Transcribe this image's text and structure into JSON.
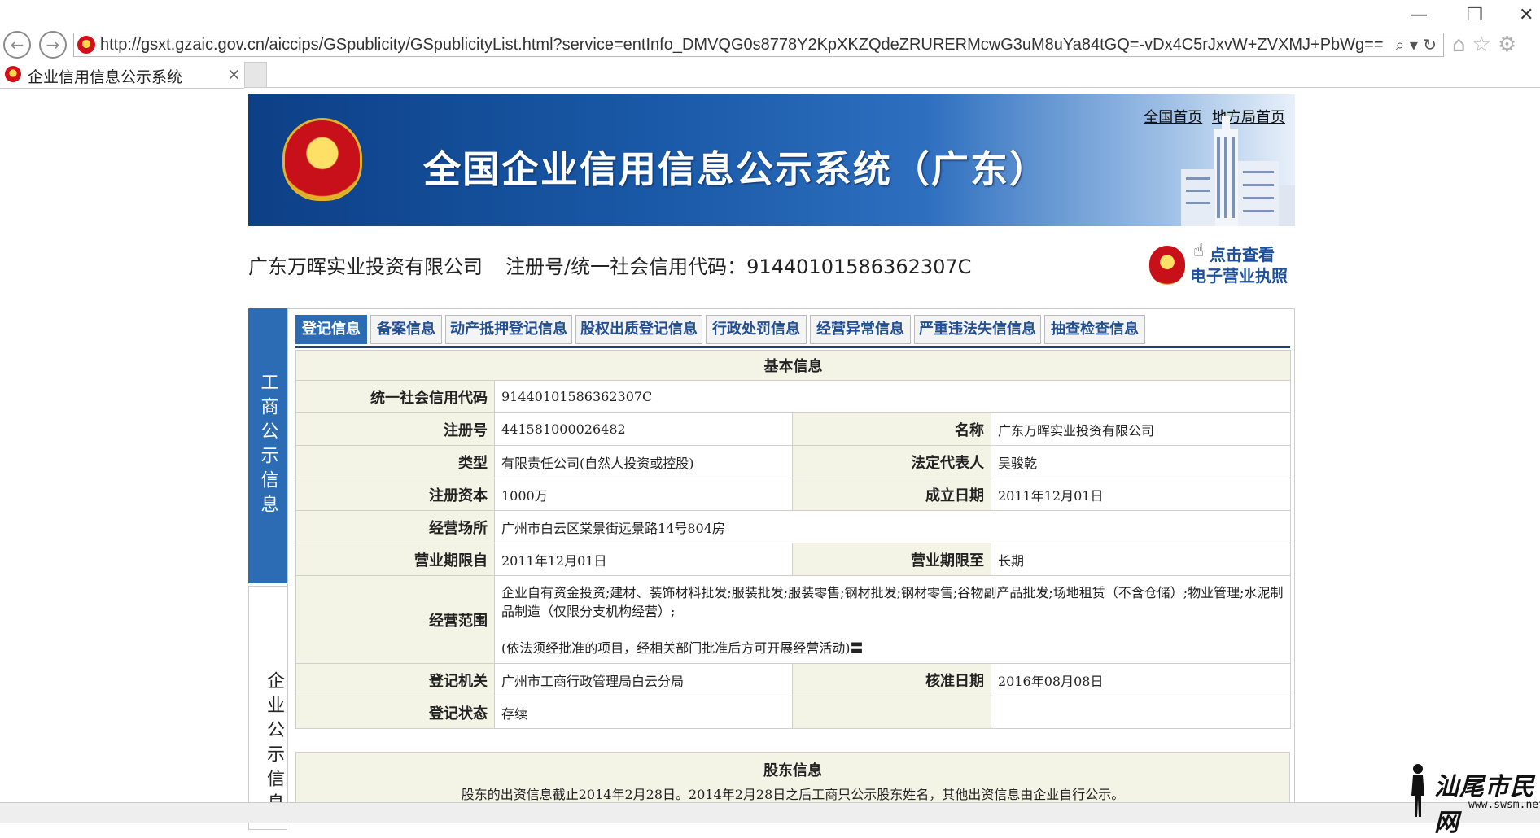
{
  "browser": {
    "url": "http://gsxt.gzaic.gov.cn/aiccips/GSpublicity/GSpublicityList.html?service=entInfo_DMVQG0s8778Y2KpXKZQdeZRURERMcwG3uM8uYa84tGQ=-vDx4C5rJxvW+ZVXMJ+PbWg==",
    "tab_title": "企业信用信息公示系统",
    "tab_close": "×"
  },
  "banner": {
    "title": "全国企业信用信息公示系统（广东）",
    "link_national": "全国首页",
    "link_local": "地方局首页"
  },
  "company": {
    "name": "广东万晖实业投资有限公司",
    "code_label": "注册号/统一社会信用代码：91440101586362307C",
    "license_line1": "点击查看",
    "license_line2": "电子营业执照"
  },
  "side_nav": [
    {
      "label": "工商公示信息"
    },
    {
      "label": "企业公示信息"
    }
  ],
  "tabs": [
    {
      "label": "登记信息"
    },
    {
      "label": "备案信息"
    },
    {
      "label": "动产抵押登记信息"
    },
    {
      "label": "股权出质登记信息"
    },
    {
      "label": "行政处罚信息"
    },
    {
      "label": "经营异常信息"
    },
    {
      "label": "严重违法失信信息"
    },
    {
      "label": "抽查检查信息"
    }
  ],
  "basic": {
    "section_title": "基本信息",
    "credit_code_label": "统一社会信用代码",
    "credit_code": "91440101586362307C",
    "reg_no_label": "注册号",
    "reg_no": "441581000026482",
    "name_label": "名称",
    "name": "广东万晖实业投资有限公司",
    "type_label": "类型",
    "type": "有限责任公司(自然人投资或控股)",
    "legal_rep_label": "法定代表人",
    "legal_rep": "吴骏乾",
    "capital_label": "注册资本",
    "capital": "1000万",
    "founded_label": "成立日期",
    "founded": "2011年12月01日",
    "address_label": "经营场所",
    "address": "广州市白云区棠景街远景路14号804房",
    "term_from_label": "营业期限自",
    "term_from": "2011年12月01日",
    "term_to_label": "营业期限至",
    "term_to": "长期",
    "scope_label": "经营范围",
    "scope_line1": "企业自有资金投资;建材、装饰材料批发;服装批发;服装零售;钢材批发;钢材零售;谷物副产品批发;场地租赁（不含仓储）;物业管理;水泥制品制造（仅限分支机构经营）;",
    "scope_line2": "(依法须经批准的项目，经相关部门批准后方可开展经营活动)〓",
    "authority_label": "登记机关",
    "authority": "广州市工商行政管理局白云分局",
    "approved_label": "核准日期",
    "approved": "2016年08月08日",
    "status_label": "登记状态",
    "status": "存续"
  },
  "shareholders": {
    "title": "股东信息",
    "note": "股东的出资信息截止2014年2月28日。2014年2月28日之后工商只公示股东姓名，其他出资信息由企业自行公示。"
  },
  "watermark": {
    "text": "汕尾市民网",
    "url": "www.swsm.net"
  }
}
